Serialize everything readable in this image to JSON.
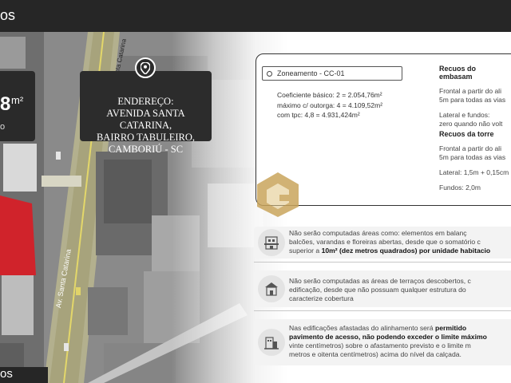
{
  "header": {
    "title": "os"
  },
  "footer": {
    "title": "os"
  },
  "area_box": {
    "value": "8",
    "unit": "m²",
    "sub": "o"
  },
  "address": {
    "lines": [
      "ENDEREÇO:",
      "AVENIDA SANTA CATARINA,",
      "BAIRRO TABULEIRO,",
      "CAMBORIÚ - SC"
    ],
    "icon": "location-pin-icon"
  },
  "map": {
    "street_labels": [
      "Av. Santa Catarina",
      "Santa Catarina"
    ]
  },
  "zoning": {
    "tag": "Zoneamento - CC-01",
    "coef_lines": [
      "Coeficiente básico: 2 = 2.054,76m²",
      "máximo c/ outorga: 4 = 4.109,52m²",
      "com tpc: 4,8  = 4.931,424m²"
    ]
  },
  "recuos_embasamento": {
    "title": "Recuos do embasam",
    "lines": [
      "Frontal a partir do ali",
      "5m para todas as vias",
      "",
      "Lateral e fundos:",
      "zero quando não volt"
    ]
  },
  "recuos_torre": {
    "title": "Recuos da torre",
    "lines": [
      "Frontal a partir do ali",
      "5m para todas as vias",
      "",
      "Lateral: 1,5m + 0,15cm",
      "",
      "Fundos: 2,0m"
    ]
  },
  "info": [
    {
      "icon": "balcony-building-icon",
      "lines": [
        "Não serão computadas áreas como: elementos em balanç",
        "balcões, varandas e floreiras abertas, desde que o somatório c"
      ],
      "last_plain": "superior a ",
      "last_bold": "10m² (dez metros quadrados) por unidade habitacio"
    },
    {
      "icon": "terrace-building-icon",
      "lines": [
        "Não serão computadas as áreas de terraços descobertos, c",
        "edificação, desde que não possuam qualquer estrutura do",
        "caracterize cobertura"
      ]
    },
    {
      "icon": "setback-building-icon",
      "first_plain": "Nas edificações afastadas do alinhamento será ",
      "first_bold": "permitido",
      "second_bold": "pavimento de acesso, não podendo exceder o limite máximo",
      "lines": [
        "vinte centímetros) sobre o afastamento previsto e o limite m",
        "metros e oitenta centímetros) acima do nível da calçada."
      ]
    }
  ],
  "colors": {
    "header": "#262626",
    "highlight_lot": "#d0232b",
    "logo_gold": "#c9a45c"
  }
}
